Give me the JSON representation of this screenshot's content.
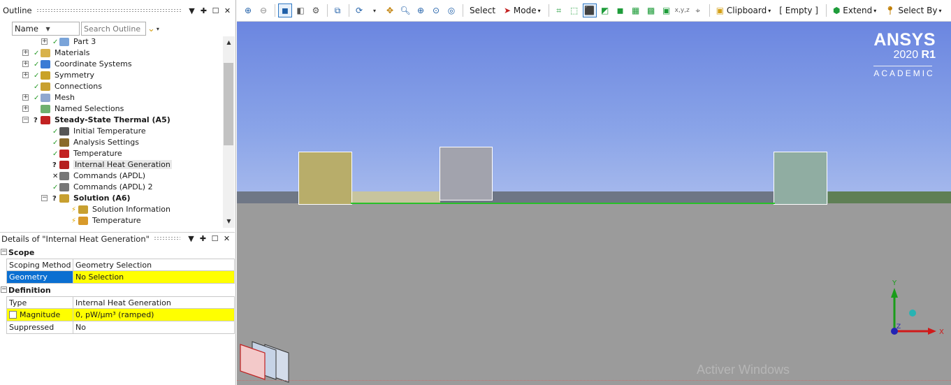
{
  "outline": {
    "title": "Outline",
    "sort_field": "Name",
    "search_placeholder": "Search Outline",
    "tree": [
      {
        "label": "Part 3",
        "status": "ok"
      },
      {
        "label": "Materials",
        "status": "ok"
      },
      {
        "label": "Coordinate Systems",
        "status": "ok"
      },
      {
        "label": "Symmetry",
        "status": "ok"
      },
      {
        "label": "Connections",
        "status": "ok"
      },
      {
        "label": "Mesh",
        "status": "ok"
      },
      {
        "label": "Named Selections",
        "status": ""
      },
      {
        "label": "Steady-State Thermal (A5)",
        "status": "?"
      },
      {
        "label": "Initial Temperature",
        "status": "ok"
      },
      {
        "label": "Analysis Settings",
        "status": "ok"
      },
      {
        "label": "Temperature",
        "status": "ok"
      },
      {
        "label": "Internal Heat Generation",
        "status": "?"
      },
      {
        "label": "Commands (APDL)",
        "status": "x"
      },
      {
        "label": "Commands (APDL) 2",
        "status": "ok"
      },
      {
        "label": "Solution (A6)",
        "status": "?"
      },
      {
        "label": "Solution Information",
        "status": "bolt"
      },
      {
        "label": "Temperature",
        "status": "bolt"
      }
    ]
  },
  "details": {
    "title": "Details of \"Internal Heat Generation\"",
    "sections": [
      {
        "name": "Scope",
        "rows": [
          {
            "key": "Scoping Method",
            "value": "Geometry Selection"
          },
          {
            "key": "Geometry",
            "value": "No Selection"
          }
        ]
      },
      {
        "name": "Definition",
        "rows": [
          {
            "key": "Type",
            "value": "Internal Heat Generation"
          },
          {
            "key": "Magnitude",
            "value": "0, pW/µm³  (ramped)"
          },
          {
            "key": "Suppressed",
            "value": "No"
          }
        ]
      }
    ]
  },
  "toolbar": {
    "select": "Select",
    "mode": "Mode",
    "clipboard": "Clipboard",
    "empty": "[ Empty ]",
    "extend": "Extend",
    "select_by": "Select By"
  },
  "viewport": {
    "brand_name": "ANSYS",
    "brand_version_year": "2020",
    "brand_version_release": "R1",
    "brand_edition": "ACADEMIC",
    "watermark": "Activer Windows",
    "triad": {
      "y": "Y",
      "x": "X",
      "z": "Z"
    }
  },
  "colors": {
    "selection_blue": "#0b6fd1",
    "warning_yellow": "#ffff00",
    "status_green": "#2c9d2c",
    "ground_gray": "#9b9b9b"
  }
}
